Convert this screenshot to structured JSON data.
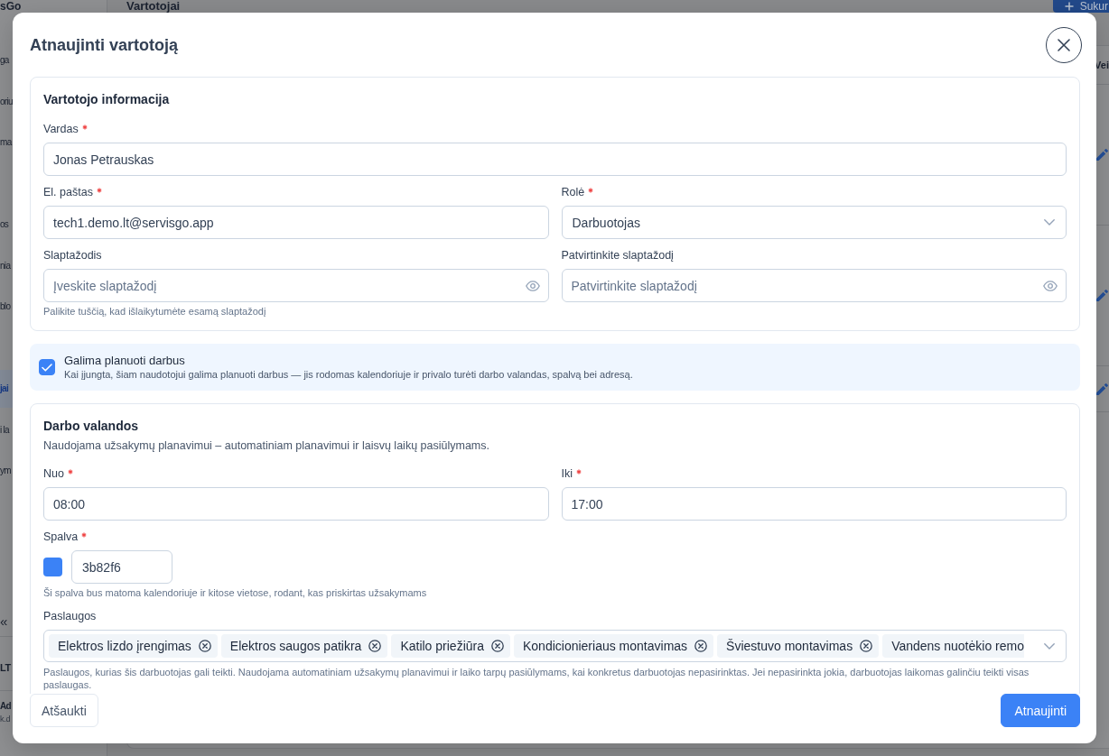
{
  "background": {
    "sidebar": {
      "logo": "sGo",
      "groups": [
        {
          "items": [
            {
              "label": "ga",
              "selected": false
            },
            {
              "label": "oriu",
              "selected": false
            },
            {
              "label": "ma",
              "selected": false
            }
          ]
        },
        {
          "items": [
            {
              "label": "os",
              "selected": false
            },
            {
              "label": "nia",
              "selected": false
            },
            {
              "label": "blo",
              "selected": false
            }
          ]
        },
        {
          "items": [
            {
              "label": "jai",
              "selected": true
            },
            {
              "label": "i la",
              "selected": false
            },
            {
              "label": "ym",
              "selected": false
            }
          ]
        }
      ],
      "collapse_button": "«",
      "language": "LT",
      "user": {
        "name": "Ad",
        "email": "k.d"
      }
    },
    "page_title": "Vartotojai",
    "create_button": "Sukur",
    "table": {
      "column_header": "Vei"
    }
  },
  "dialog": {
    "title": "Atnaujinti vartotoją",
    "user_info": {
      "title": "Vartotojo informacija",
      "rows": [
        {
          "fields": [
            {
              "kind": "text",
              "label": "Vardas",
              "required": true,
              "value": "Jonas Petrauskas"
            }
          ]
        },
        {
          "fields": [
            {
              "kind": "text",
              "label": "El. paštas",
              "required": true,
              "value": "tech1.demo.lt@servisgo.app"
            },
            {
              "kind": "select",
              "label": "Rolė",
              "required": true,
              "value": "Darbuotojas"
            }
          ]
        },
        {
          "fields": [
            {
              "kind": "password",
              "label": "Slaptažodis",
              "required": false,
              "placeholder": "Įveskite slaptažodį",
              "hint": "Palikite tuščią, kad išlaikytumėte esamą slaptažodį"
            },
            {
              "kind": "password",
              "label": "Patvirtinkite slaptažodį",
              "required": false,
              "placeholder": "Patvirtinkite slaptažodį"
            }
          ]
        }
      ]
    },
    "scheduling": {
      "checked": true,
      "title": "Galima planuoti darbus",
      "description": "Kai įjungta, šiam naudotojui galima planuoti darbus — jis rodomas kalendoriuje ir privalo turėti darbo valandas, spalvą bei adresą."
    },
    "working_hours": {
      "title": "Darbo valandos",
      "description": "Naudojama užsakymų planavimui – automatiniam planavimui ir laisvų laikų pasiūlymams.",
      "rows": [
        {
          "fields": [
            {
              "kind": "text",
              "label": "Nuo",
              "required": true,
              "value": "08:00"
            },
            {
              "kind": "text",
              "label": "Iki",
              "required": true,
              "value": "17:00"
            }
          ]
        }
      ],
      "color_field": {
        "label": "Spalva",
        "required": true,
        "color": "#3b82f6",
        "value": "3b82f6",
        "hint": "Ši spalva bus matoma kalendoriuje ir kitose vietose, rodant, kas priskirtas užsakymams"
      },
      "services": {
        "label": "Paslaugos",
        "required": false,
        "chips": [
          {
            "label": "Elektros lizdo įrengimas",
            "clipped": false
          },
          {
            "label": "Elektros saugos patikra",
            "clipped": false
          },
          {
            "label": "Katilo priežiūra",
            "clipped": false
          },
          {
            "label": "Kondicionieriaus montavimas",
            "clipped": false
          },
          {
            "label": "Šviestuvo montavimas",
            "clipped": false
          },
          {
            "label": "Vandens nuotėkio remo",
            "clipped": true
          }
        ],
        "hint": "Paslaugos, kurias šis darbuotojas gali teikti. Naudojama automatiniam užsakymų planavimui ir laiko tarpų pasiūlymams, kai konkretus darbuotojas nepasirinktas. Jei nepasirinkta jokia, darbuotojas laikomas galinčiu teikti visas paslaugas."
      }
    },
    "footer": {
      "cancel_button": "Atšaukti",
      "submit_button": "Atnaujinti"
    }
  }
}
